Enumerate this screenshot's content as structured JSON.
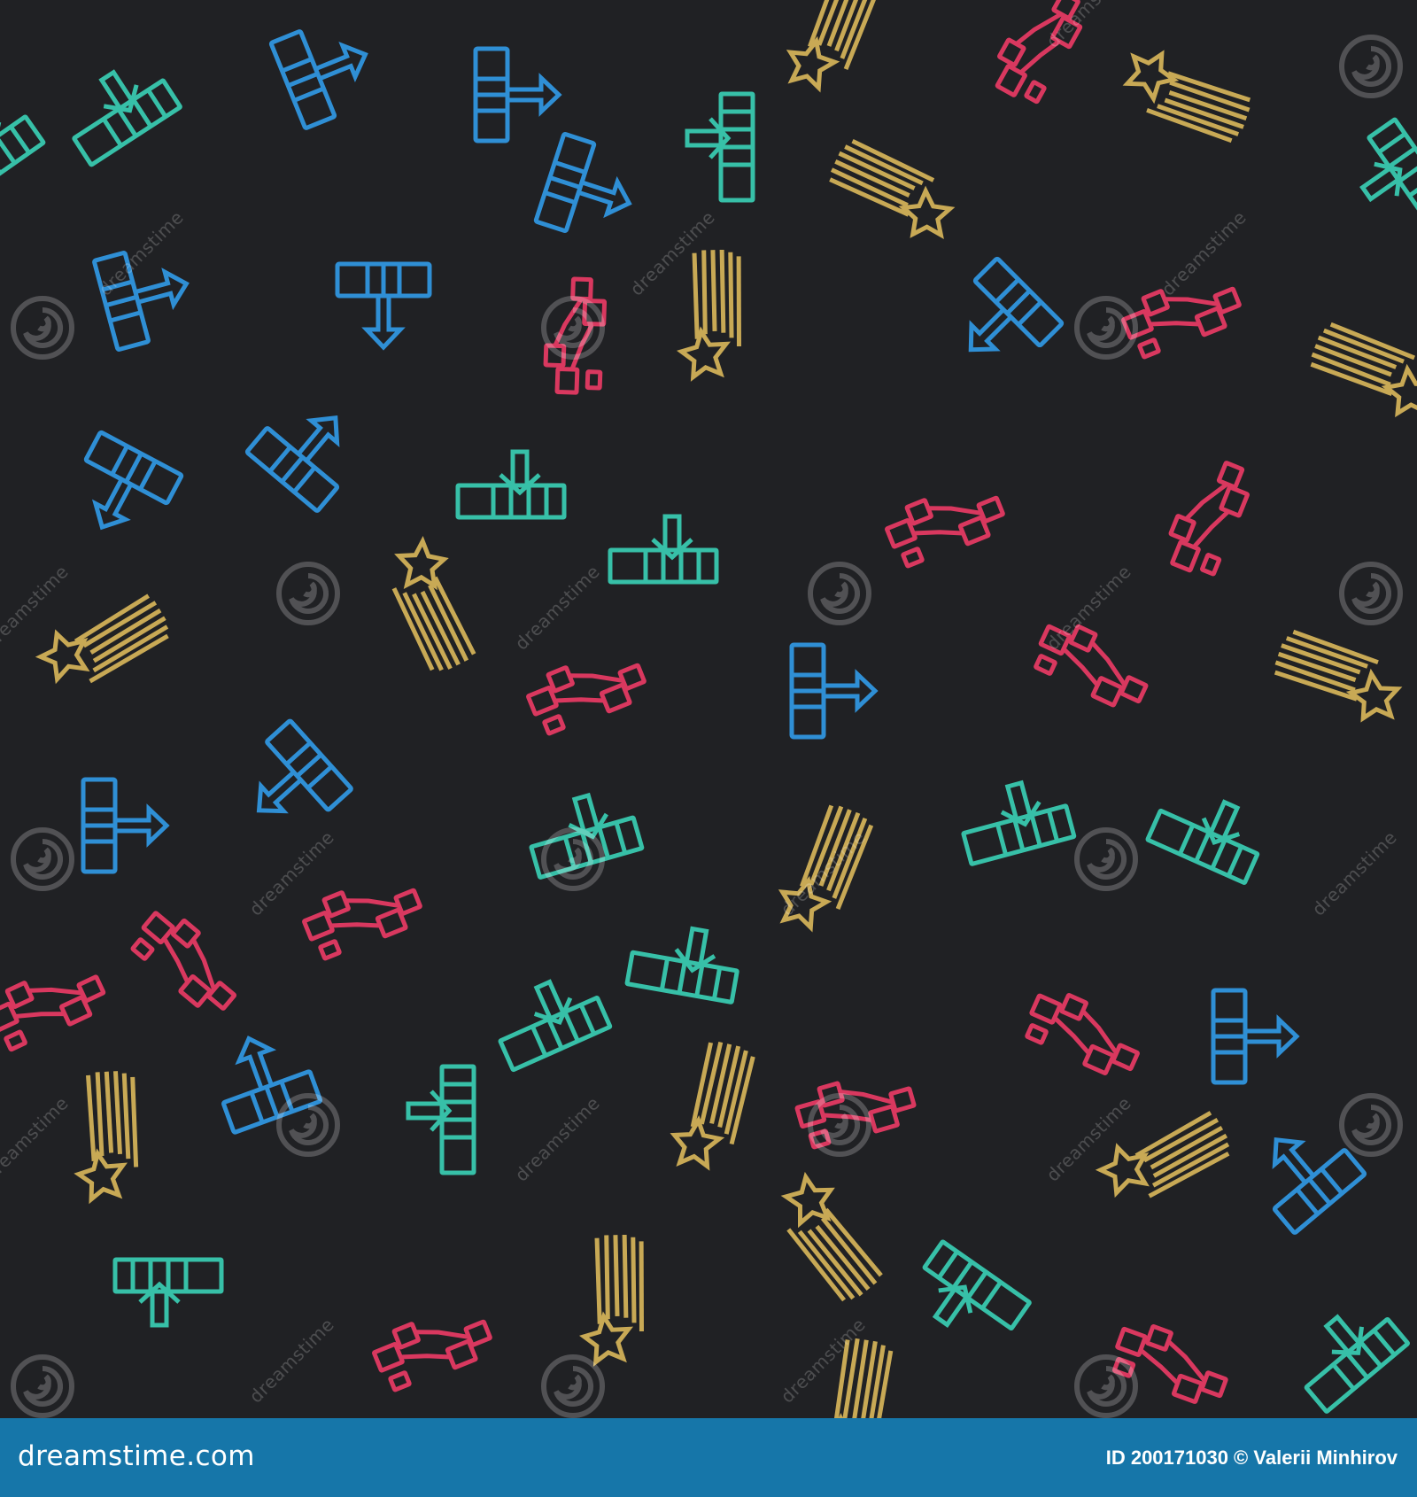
{
  "footer": {
    "brand": "dreamstime.com",
    "credit": "ID 200171030 © Valerii Minhirov"
  },
  "watermark": {
    "text": "dreamstime",
    "icon": "spiral-logo-icon"
  },
  "colors": {
    "background": "#202124",
    "footer": "#1676a9",
    "blue": "#2f8fd5",
    "green": "#37c0a8",
    "red": "#d9385f",
    "gold": "#c8a955"
  },
  "icons": {
    "blue": "sliders-arrow-icon",
    "green": "column-arrow-icon",
    "red": "connected-blocks-icon",
    "gold": "shooting-star-icon"
  }
}
